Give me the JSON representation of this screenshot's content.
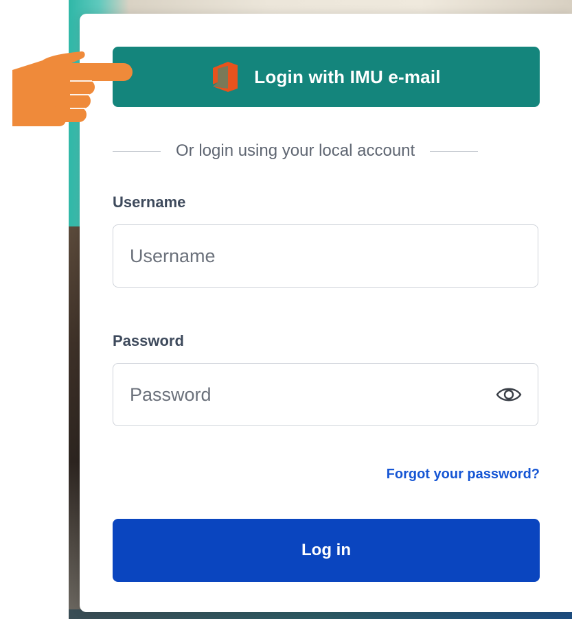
{
  "colors": {
    "sso_button": "#14857c",
    "primary_button": "#0a45bf",
    "link": "#1656d4",
    "pointer_hand": "#ef8a3a"
  },
  "sso": {
    "icon": "office-icon",
    "label": "Login with IMU e-mail"
  },
  "divider": {
    "text": "Or login using your local account"
  },
  "username": {
    "label": "Username",
    "placeholder": "Username",
    "value": ""
  },
  "password": {
    "label": "Password",
    "placeholder": "Password",
    "value": "",
    "toggle_icon": "eye-icon"
  },
  "forgot_password": {
    "label": "Forgot your password?"
  },
  "login_button": {
    "label": "Log in"
  },
  "annotation": {
    "icon": "pointing-hand-icon"
  }
}
